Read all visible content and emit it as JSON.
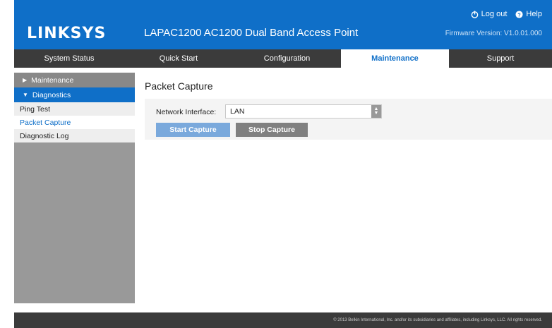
{
  "header": {
    "logo": "LINKSYS",
    "product": "LAPAC1200 AC1200 Dual Band Access Point",
    "logout_label": "Log out",
    "help_label": "Help",
    "firmware": "Firmware Version: V1.0.01.000",
    "bg_color": "#0f6fc8"
  },
  "nav": {
    "tabs": [
      {
        "label": "System Status"
      },
      {
        "label": "Quick Start"
      },
      {
        "label": "Configuration"
      },
      {
        "label": "Maintenance"
      },
      {
        "label": "Support"
      }
    ],
    "active": "Maintenance"
  },
  "sidebar": {
    "groups": [
      {
        "label": "Maintenance",
        "icon": "caret-right-icon"
      },
      {
        "label": "Diagnostics",
        "icon": "caret-down-icon"
      }
    ],
    "items": [
      {
        "label": "Ping Test"
      },
      {
        "label": "Packet Capture"
      },
      {
        "label": "Diagnostic Log"
      }
    ],
    "selected": "Packet Capture"
  },
  "main": {
    "title": "Packet Capture",
    "network_interface_label": "Network Interface:",
    "network_interface_value": "LAN",
    "start_label": "Start Capture",
    "stop_label": "Stop Capture"
  },
  "footer": {
    "text": "© 2013 Belkin International, Inc. and/or its subsidiaries and affiliates, including Linksys, LLC. All rights reserved."
  }
}
